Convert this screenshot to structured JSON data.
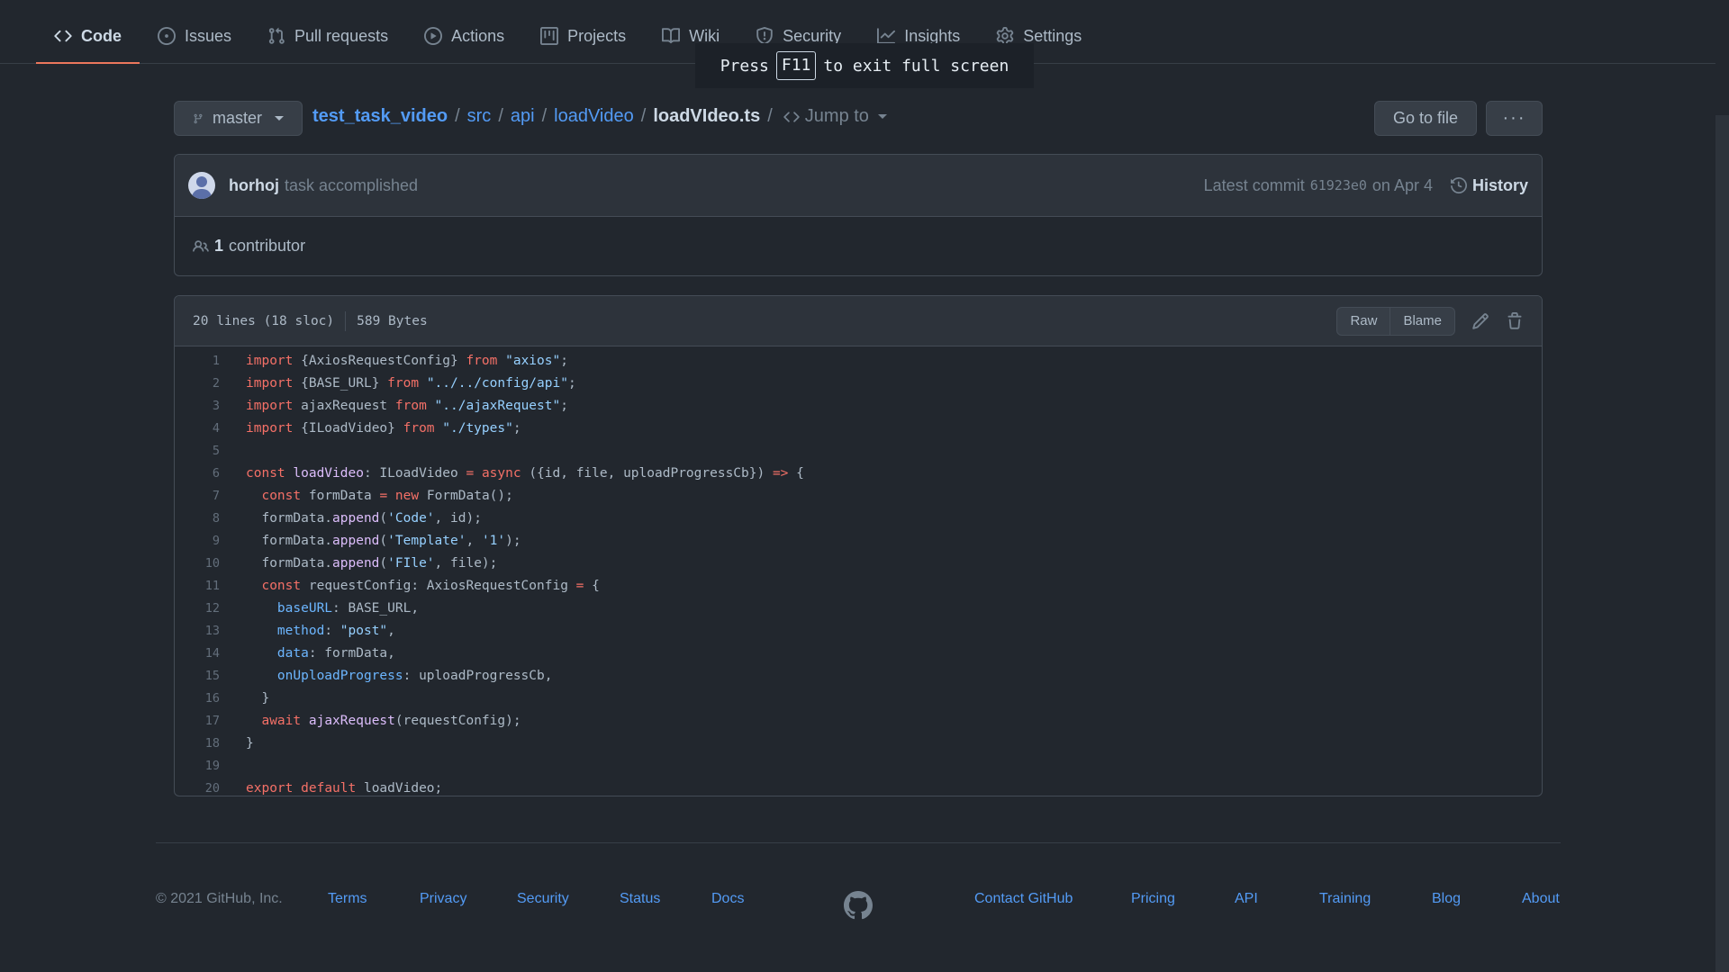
{
  "nav": {
    "tabs": [
      {
        "label": "Code",
        "icon": "code-icon"
      },
      {
        "label": "Issues",
        "icon": "issue-icon"
      },
      {
        "label": "Pull requests",
        "icon": "pull-request-icon"
      },
      {
        "label": "Actions",
        "icon": "play-icon"
      },
      {
        "label": "Projects",
        "icon": "project-icon"
      },
      {
        "label": "Wiki",
        "icon": "book-icon"
      },
      {
        "label": "Security",
        "icon": "shield-icon"
      },
      {
        "label": "Insights",
        "icon": "graph-icon"
      },
      {
        "label": "Settings",
        "icon": "gear-icon"
      }
    ]
  },
  "fullscreen_tip": {
    "press": "Press",
    "key": "F11",
    "rest": "to exit full screen"
  },
  "branch": {
    "name": "master"
  },
  "breadcrumb": {
    "repo": "test_task_video",
    "parts": [
      "src",
      "api",
      "loadVideo"
    ],
    "file": "loadVIdeo.ts",
    "jump": "Jump to"
  },
  "buttons": {
    "go_to_file": "Go to file",
    "more": "···"
  },
  "commit": {
    "author": "horhoj",
    "message": "task accomplished",
    "latest_label": "Latest commit",
    "sha": "61923e0",
    "date": "on Apr 4",
    "history": "History"
  },
  "contributors": {
    "count": "1",
    "label": "contributor"
  },
  "file": {
    "lines_info": "20 lines (18 sloc)",
    "size": "589 Bytes",
    "raw": "Raw",
    "blame": "Blame",
    "line_numbers": [
      "1",
      "2",
      "3",
      "4",
      "5",
      "6",
      "7",
      "8",
      "9",
      "10",
      "11",
      "12",
      "13",
      "14",
      "15",
      "16",
      "17",
      "18",
      "19",
      "20"
    ]
  },
  "footer": {
    "copyright": "© 2021 GitHub, Inc.",
    "links": [
      "Terms",
      "Privacy",
      "Security",
      "Status",
      "Docs",
      "Contact GitHub",
      "Pricing",
      "API",
      "Training",
      "Blog",
      "About"
    ]
  },
  "colors": {
    "accent": "#539bf5",
    "selected_tab_underline": "#ec775c",
    "background": "#22272e"
  }
}
